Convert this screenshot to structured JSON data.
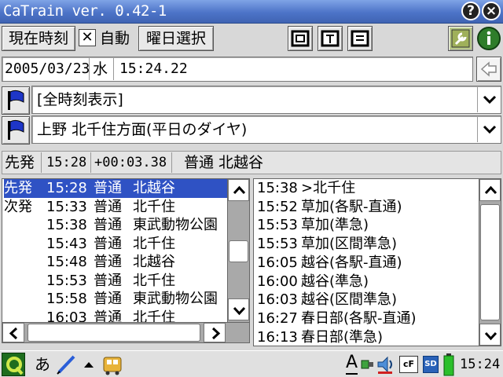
{
  "window": {
    "title": "CaTrain ver. 0.42-1",
    "help_label": "?",
    "close_label": "×"
  },
  "toolbar": {
    "now_label": "現在時刻",
    "auto_label": "自動",
    "auto_checked_glyph": "✕",
    "weekday_label": "曜日選択"
  },
  "datetime": {
    "date": "2005/03/23",
    "weekday": "水",
    "time": "15:24.22"
  },
  "selectors": {
    "time_filter": "[全時刻表示]",
    "route": "上野 北千住方面(平日のダイヤ)"
  },
  "status": {
    "label": "先発",
    "time": "15:28",
    "countdown": "+00:03.38",
    "train": "普通 北越谷"
  },
  "departures": [
    {
      "label": "先発",
      "time": "15:28",
      "type": "普通",
      "dest": "北越谷",
      "selected": true
    },
    {
      "label": "次発",
      "time": "15:33",
      "type": "普通",
      "dest": "北千住"
    },
    {
      "label": "",
      "time": "15:38",
      "type": "普通",
      "dest": "東武動物公園"
    },
    {
      "label": "",
      "time": "15:43",
      "type": "普通",
      "dest": "北千住"
    },
    {
      "label": "",
      "time": "15:48",
      "type": "普通",
      "dest": "北越谷"
    },
    {
      "label": "",
      "time": "15:53",
      "type": "普通",
      "dest": "北千住"
    },
    {
      "label": "",
      "time": "15:58",
      "type": "普通",
      "dest": "東武動物公園"
    },
    {
      "label": "",
      "time": "16:03",
      "type": "普通",
      "dest": "北千住"
    }
  ],
  "connections": [
    {
      "time": "15:38",
      "dest": ">北千住"
    },
    {
      "time": "15:52",
      "dest": "草加(各駅-直通)"
    },
    {
      "time": "15:53",
      "dest": "草加(準急)"
    },
    {
      "time": "15:53",
      "dest": "草加(区間準急)"
    },
    {
      "time": "16:05",
      "dest": "越谷(各駅-直通)"
    },
    {
      "time": "16:00",
      "dest": "越谷(準急)"
    },
    {
      "time": "16:03",
      "dest": "越谷(区間準急)"
    },
    {
      "time": "16:27",
      "dest": "春日部(各駅-直通)"
    },
    {
      "time": "16:13",
      "dest": "春日部(準急)"
    }
  ],
  "taskbar": {
    "input_mode": "あ",
    "font_indicator": "A",
    "cf_label": "cF",
    "sd_label": "SD",
    "clock": "15:24"
  },
  "colors": {
    "title_bar": "#4d74c8",
    "selection": "#2f52c4"
  }
}
